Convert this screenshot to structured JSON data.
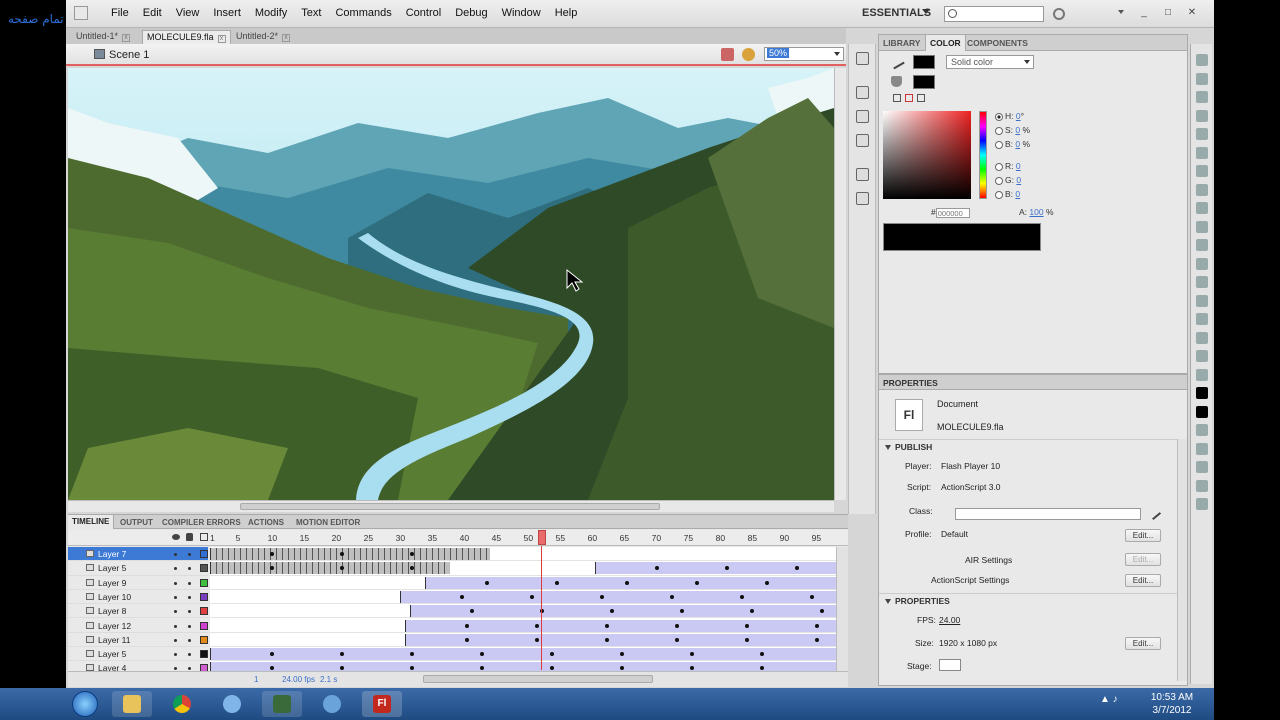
{
  "overlay_text": "تمام صفحه",
  "menu": [
    "File",
    "Edit",
    "View",
    "Insert",
    "Modify",
    "Text",
    "Commands",
    "Control",
    "Debug",
    "Window",
    "Help"
  ],
  "workspace": "ESSENTIALS",
  "window_controls": [
    "_",
    "□",
    "✕"
  ],
  "doc_tabs": [
    {
      "label": "Untitled-1*",
      "active": false
    },
    {
      "label": "MOLECULE9.fla",
      "active": true
    },
    {
      "label": "Untitled-2*",
      "active": false
    }
  ],
  "scene": "Scene 1",
  "zoom": "50%",
  "panel_tabs": [
    "LIBRARY",
    "COLOR",
    "COMPONENTS"
  ],
  "color_panel": {
    "type": "Solid color",
    "H": "0",
    "H_unit": "°",
    "S": "0",
    "S_unit": "%",
    "B": "0",
    "B_unit": "%",
    "R": "0",
    "G": "0",
    "Bv": "0",
    "hex_label": "#",
    "hex": "000000",
    "alpha_label": "A:",
    "alpha": "100",
    "alpha_unit": "%",
    "labels": {
      "h": "H:",
      "s": "S:",
      "b": "B:",
      "r": "R:",
      "g": "G:",
      "bl": "B:"
    }
  },
  "properties": {
    "title": "PROPERTIES",
    "doc_icon": "Fl",
    "doc_type": "Document",
    "doc_name": "MOLECULE9.fla",
    "publish_header": "PUBLISH",
    "player_label": "Player:",
    "player": "Flash Player 10",
    "script_label": "Script:",
    "script": "ActionScript 3.0",
    "class_label": "Class:",
    "profile_label": "Profile:",
    "profile": "Default",
    "air_settings": "AIR Settings",
    "as_settings": "ActionScript Settings",
    "props_header": "PROPERTIES",
    "fps_label": "FPS:",
    "fps": "24.00",
    "size_label": "Size:",
    "size": "1920 x 1080 px",
    "stage_label": "Stage:",
    "edit": "Edit..."
  },
  "timeline_tabs": [
    "TIMELINE",
    "OUTPUT",
    "COMPILER ERRORS",
    "ACTIONS",
    "MOTION EDITOR"
  ],
  "frame_numbers": [
    "1",
    "5",
    "10",
    "15",
    "20",
    "25",
    "30",
    "35",
    "40",
    "45",
    "50",
    "55",
    "60",
    "65",
    "70",
    "75",
    "80",
    "85",
    "90",
    "95"
  ],
  "layers": [
    {
      "name": "Layer 7",
      "color": "#2f6fd6",
      "selected": true
    },
    {
      "name": "Layer 5",
      "color": "#555555",
      "selected": false
    },
    {
      "name": "Layer 9",
      "color": "#3fbf3f",
      "selected": false
    },
    {
      "name": "Layer 10",
      "color": "#7a3fbf",
      "selected": false
    },
    {
      "name": "Layer 8",
      "color": "#e04040",
      "selected": false
    },
    {
      "name": "Layer 12",
      "color": "#d040d0",
      "selected": false
    },
    {
      "name": "Layer 11",
      "color": "#e08a1a",
      "selected": false
    },
    {
      "name": "Layer 5",
      "color": "#111111",
      "selected": false
    },
    {
      "name": "Layer 4",
      "color": "#d060d0",
      "selected": false
    }
  ],
  "timeline_footer": {
    "frame": "1",
    "fps": "24.00",
    "fps_unit": "fps",
    "time": "2.1",
    "time_unit": "s"
  },
  "clock": {
    "time": "10:53 AM",
    "date": "3/7/2012"
  },
  "taskbar_apps": [
    "start-orb",
    "explorer",
    "chrome",
    "itunes",
    "app",
    "itunes2",
    "flash"
  ],
  "flash_icon_label": "Fl"
}
